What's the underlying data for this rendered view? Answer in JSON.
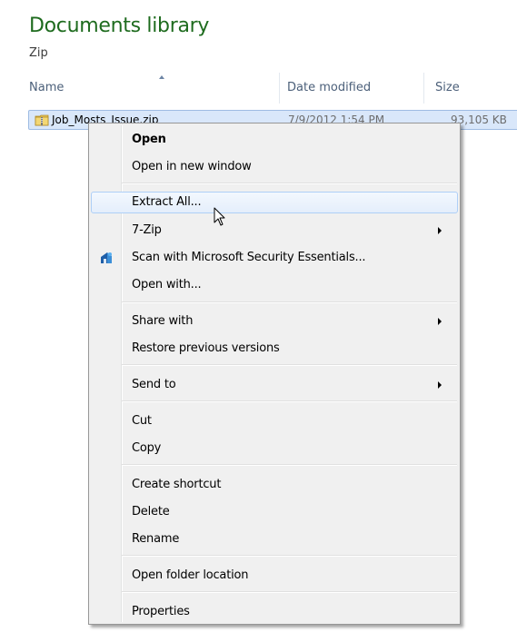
{
  "library": {
    "title": "Documents library",
    "subtitle": "Zip"
  },
  "columns": {
    "name": "Name",
    "date": "Date modified",
    "size": "Size"
  },
  "file": {
    "name": "Job_Mosts_Issue.zip",
    "date": "7/9/2012 1:54 PM",
    "size": "93,105 KB",
    "icon": "zip-folder-icon"
  },
  "context_menu": {
    "items": [
      {
        "label": "Open",
        "bold": true
      },
      {
        "label": "Open in new window"
      },
      {
        "label": "Extract All...",
        "hovered": true
      },
      {
        "label": "7-Zip",
        "submenu": true
      },
      {
        "label": "Scan with Microsoft Security Essentials...",
        "icon": "microsoft-security-essentials-icon"
      },
      {
        "label": "Open with..."
      },
      {
        "label": "Share with",
        "submenu": true
      },
      {
        "label": "Restore previous versions"
      },
      {
        "label": "Send to",
        "submenu": true
      },
      {
        "label": "Cut"
      },
      {
        "label": "Copy"
      },
      {
        "label": "Create shortcut"
      },
      {
        "label": "Delete"
      },
      {
        "label": "Rename"
      },
      {
        "label": "Open folder location"
      },
      {
        "label": "Properties"
      }
    ]
  },
  "colors": {
    "title_green": "#1e6b1e",
    "selection_blue": "#d9e7fa",
    "menu_background": "#f0f0f0",
    "hover_border": "#aecff7"
  }
}
